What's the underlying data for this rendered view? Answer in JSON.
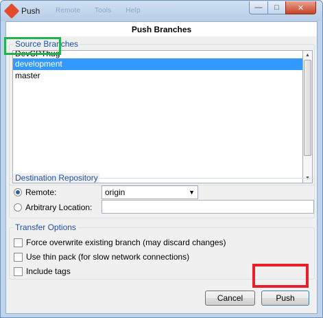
{
  "window": {
    "title": "Push",
    "faded_menu": [
      "Remote",
      "Tools",
      "Help"
    ],
    "controls": {
      "minimize": "—",
      "maximize": "□",
      "close": "✕"
    }
  },
  "dialog": {
    "header": "Push Branches"
  },
  "source_branches": {
    "legend": "Source Branches",
    "items": [
      {
        "label": "DevCPThug",
        "selected": false
      },
      {
        "label": "development",
        "selected": true
      },
      {
        "label": "master",
        "selected": false
      }
    ]
  },
  "destination": {
    "legend": "Destination Repository",
    "remote_label": "Remote:",
    "remote_value": "origin",
    "arbitrary_label": "Arbitrary Location:",
    "arbitrary_value": "",
    "selected_option": "remote"
  },
  "transfer": {
    "legend": "Transfer Options",
    "options": [
      {
        "label": "Force overwrite existing branch (may discard changes)",
        "checked": false
      },
      {
        "label": "Use thin pack (for slow network connections)",
        "checked": false
      },
      {
        "label": "Include tags",
        "checked": false
      }
    ]
  },
  "buttons": {
    "cancel": "Cancel",
    "push": "Push"
  },
  "colors": {
    "selection": "#3399ff",
    "legend_text": "#1f4fa8",
    "annotation_green": "#22b14c",
    "annotation_red": "#e8202a"
  }
}
